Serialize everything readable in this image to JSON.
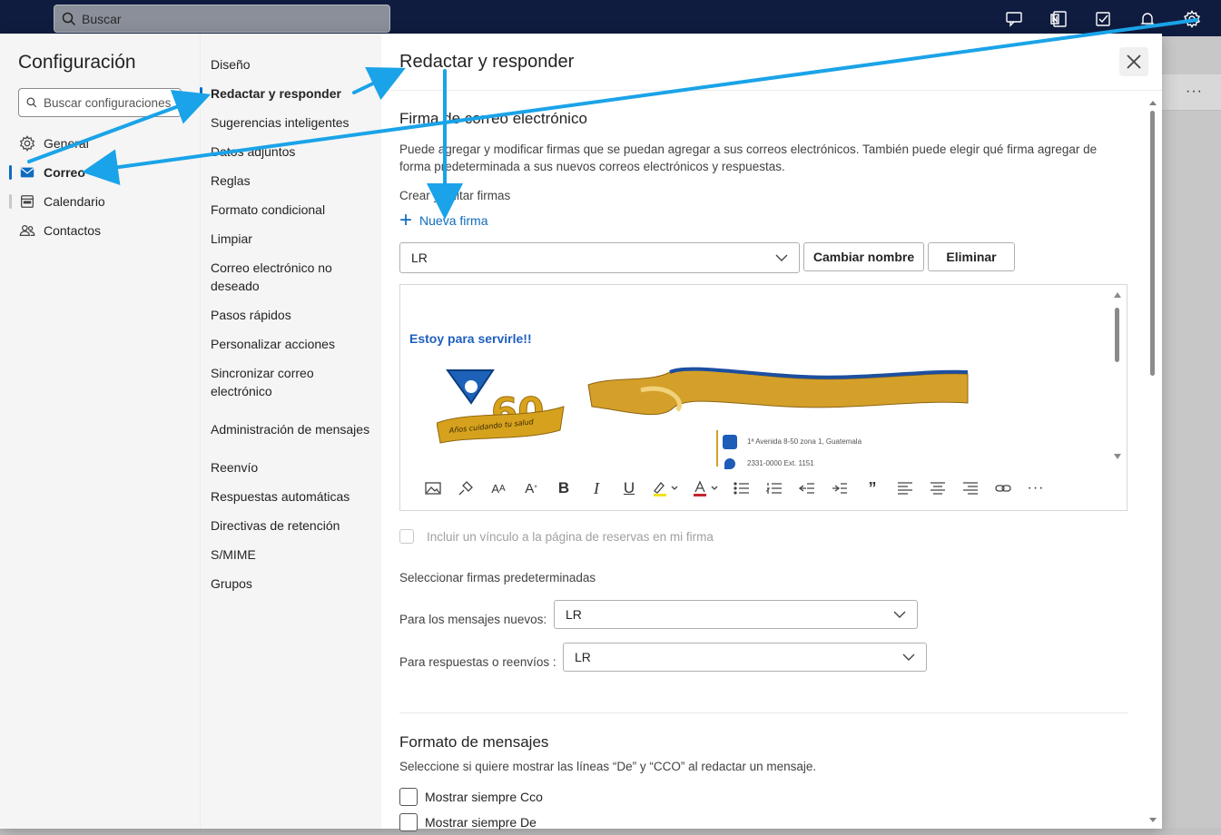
{
  "topbar": {
    "search_placeholder": "Buscar",
    "icons": [
      "feedback-icon",
      "onenote-icon",
      "todo-icon",
      "bell-icon",
      "gear-icon"
    ]
  },
  "settings": {
    "title": "Configuración",
    "search_placeholder": "Buscar configuraciones",
    "categories": [
      {
        "label": "General",
        "icon": "gear-icon"
      },
      {
        "label": "Correo",
        "icon": "mail-icon",
        "selected": true
      },
      {
        "label": "Calendario",
        "icon": "calendar-icon"
      },
      {
        "label": "Contactos",
        "icon": "people-icon"
      }
    ],
    "mail_sections": [
      {
        "label": "Diseño"
      },
      {
        "label": "Redactar y responder",
        "selected": true
      },
      {
        "label": "Sugerencias inteligentes"
      },
      {
        "label": "Datos adjuntos"
      },
      {
        "label": "Reglas"
      },
      {
        "label": "Formato condicional"
      },
      {
        "label": "Limpiar"
      },
      {
        "label": "Correo electrónico no deseado"
      },
      {
        "label": "Pasos rápidos"
      },
      {
        "label": "Personalizar acciones"
      },
      {
        "label": "Sincronizar correo electrónico"
      },
      {
        "label": "Administración de mensajes"
      },
      {
        "label": "Reenvío"
      },
      {
        "label": "Respuestas automáticas"
      },
      {
        "label": "Directivas de retención"
      },
      {
        "label": "S/MIME"
      },
      {
        "label": "Grupos"
      }
    ]
  },
  "pane": {
    "title": "Redactar y responder",
    "signature": {
      "section_title": "Firma de correo electrónico",
      "description": "Puede agregar y modificar firmas que se puedan agregar a sus correos electrónicos. También puede elegir qué firma agregar de forma predeterminada a sus nuevos correos electrónicos y respuestas.",
      "create_edit_label": "Crear y editar firmas",
      "new_signature_label": "Nueva firma",
      "selected_signature": "LR",
      "rename_button": "Cambiar nombre",
      "delete_button": "Eliminar",
      "editor_text": "Estoy para servirle!!",
      "banner_years": "60",
      "banner_caption": "Años cuidando tu salud",
      "contact_address": "1ª Avenida 8-50 zona 1, Guatemala",
      "contact_phone": "2331-0000 Ext. 1151",
      "include_booking_link": "Incluir un vínculo a la página de reservas en mi firma",
      "defaults_label": "Seleccionar firmas predeterminadas",
      "new_messages_label": "Para los mensajes nuevos:",
      "new_messages_value": "LR",
      "replies_label": "Para respuestas o reenvíos :",
      "replies_value": "LR"
    },
    "format": {
      "section_title": "Formato de mensajes",
      "description": "Seleccione si quiere mostrar las líneas “De” y “CCO” al redactar un mensaje.",
      "always_bcc": "Mostrar siempre Cco",
      "always_from": "Mostrar siempre De"
    }
  },
  "colors": {
    "accent": "#0f6cbd",
    "topbar": "#0f1c3f",
    "annotation_arrow": "#1aa3e8",
    "signature_text": "#1f5fbf"
  }
}
